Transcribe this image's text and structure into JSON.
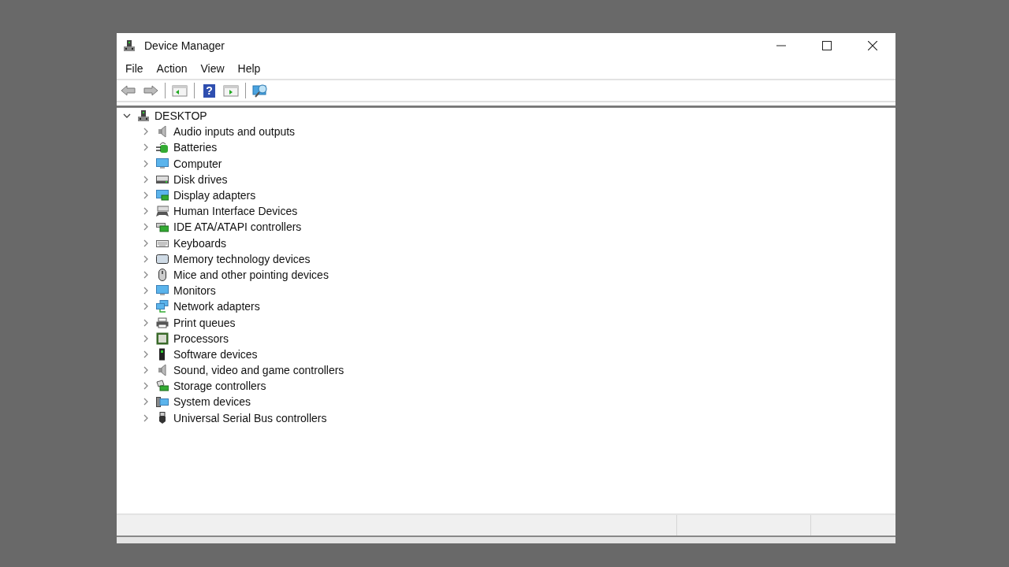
{
  "window": {
    "title": "Device Manager"
  },
  "menu": [
    "File",
    "Action",
    "View",
    "Help"
  ],
  "toolbar": [
    {
      "kind": "back"
    },
    {
      "kind": "forward"
    },
    {
      "kind": "separator"
    },
    {
      "kind": "pane-left"
    },
    {
      "kind": "separator"
    },
    {
      "kind": "help",
      "glyph": "?"
    },
    {
      "kind": "pane-right"
    },
    {
      "kind": "separator"
    },
    {
      "kind": "scan"
    }
  ],
  "tree": {
    "label": "DESKTOP",
    "expanded": true,
    "children": [
      {
        "label": "Audio inputs and outputs",
        "kind": "speaker",
        "expanded": false
      },
      {
        "label": "Batteries",
        "kind": "battery",
        "expanded": false
      },
      {
        "label": "Computer",
        "kind": "monitor",
        "expanded": false
      },
      {
        "label": "Disk drives",
        "kind": "disk",
        "expanded": false
      },
      {
        "label": "Display adapters",
        "kind": "display",
        "expanded": false
      },
      {
        "label": "Human Interface Devices",
        "kind": "hid",
        "expanded": false
      },
      {
        "label": "IDE ATA/ATAPI controllers",
        "kind": "card",
        "expanded": false
      },
      {
        "label": "Keyboards",
        "kind": "keyboard",
        "expanded": false
      },
      {
        "label": "Memory technology devices",
        "kind": "memory",
        "expanded": false
      },
      {
        "label": "Mice and other pointing devices",
        "kind": "mouse",
        "expanded": false
      },
      {
        "label": "Monitors",
        "kind": "monitor",
        "expanded": false
      },
      {
        "label": "Network adapters",
        "kind": "network",
        "expanded": false
      },
      {
        "label": "Print queues",
        "kind": "printer",
        "expanded": false
      },
      {
        "label": "Processors",
        "kind": "chip",
        "expanded": false
      },
      {
        "label": "Software devices",
        "kind": "tower",
        "expanded": false
      },
      {
        "label": "Sound, video and game controllers",
        "kind": "speaker",
        "expanded": false
      },
      {
        "label": "Storage controllers",
        "kind": "storage",
        "expanded": false
      },
      {
        "label": "System devices",
        "kind": "system",
        "expanded": false
      },
      {
        "label": "Universal Serial Bus controllers",
        "kind": "usb",
        "expanded": false
      }
    ]
  }
}
